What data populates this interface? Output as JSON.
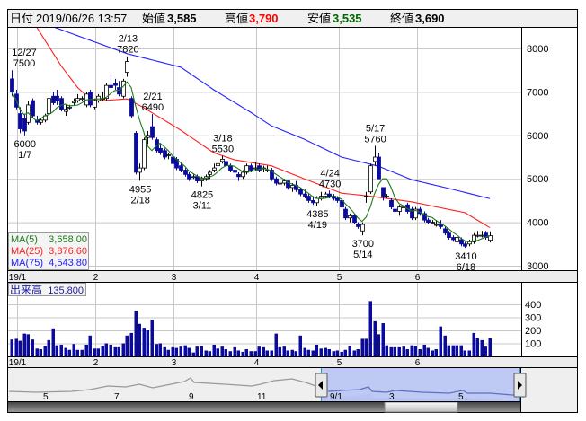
{
  "header": {
    "date_label": "日付",
    "date_value": "2019/06/26 13:57",
    "open_label": "始値",
    "open_value": "3,585",
    "high_label": "高値",
    "high_value": "3,790",
    "low_label": "安値",
    "low_value": "3,535",
    "close_label": "終値",
    "close_value": "3,690"
  },
  "colors": {
    "up": "#ffffff",
    "down": "#0a0a9c",
    "ma5": "#1a7a1a",
    "ma25": "#ff2020",
    "ma75": "#2020ff",
    "high": "#ff0000",
    "low": "#006600"
  },
  "legend": [
    {
      "label": "MA(5)",
      "value": "3,658.00",
      "color": "#1a7a1a"
    },
    {
      "label": "MA(25)",
      "value": "3,876.60",
      "color": "#ff2020"
    },
    {
      "label": "MA(75)",
      "value": "4,543.80",
      "color": "#2020ff"
    }
  ],
  "volume_legend": {
    "label": "出来高",
    "value": "135.800"
  },
  "chart_data": {
    "type": "candlestick",
    "price_axis": {
      "ticks": [
        "8000",
        "7000",
        "6000",
        "5000",
        "4000",
        "3000"
      ],
      "values": [
        8000,
        7000,
        6000,
        5000,
        4000,
        3000
      ]
    },
    "volume_axis": {
      "ticks": [
        "400",
        "300",
        "200",
        "100"
      ],
      "values": [
        400,
        300,
        200,
        100
      ]
    },
    "month_ticks": [
      {
        "label": "19/1",
        "index": 2
      },
      {
        "label": "2",
        "index": 21
      },
      {
        "label": "3",
        "index": 40
      },
      {
        "label": "4",
        "index": 60
      },
      {
        "label": "5",
        "index": 80
      },
      {
        "label": "6",
        "index": 99
      }
    ],
    "ohlc": [
      [
        7300,
        7500,
        6900,
        7000
      ],
      [
        6950,
        7050,
        6600,
        6650
      ],
      [
        6500,
        6650,
        6050,
        6150
      ],
      [
        6400,
        6500,
        6000,
        6100
      ],
      [
        6300,
        6800,
        6250,
        6700
      ],
      [
        6800,
        6850,
        6400,
        6450
      ],
      [
        6350,
        6450,
        6250,
        6300
      ],
      [
        6300,
        6400,
        6250,
        6350
      ],
      [
        6350,
        6500,
        6300,
        6450
      ],
      [
        6500,
        6900,
        6450,
        6850
      ],
      [
        6900,
        7000,
        6700,
        6750
      ],
      [
        6900,
        7050,
        6700,
        6800
      ],
      [
        6850,
        6900,
        6550,
        6600
      ],
      [
        6550,
        6700,
        6450,
        6600
      ],
      [
        6650,
        6700,
        6600,
        6650
      ],
      [
        6750,
        6850,
        6700,
        6780
      ],
      [
        6800,
        6950,
        6750,
        6850
      ],
      [
        6850,
        6900,
        6800,
        6850
      ],
      [
        6700,
        7000,
        6650,
        6950
      ],
      [
        7000,
        7050,
        6650,
        6700
      ],
      [
        6650,
        6850,
        6600,
        6800
      ],
      [
        6800,
        6950,
        6750,
        6900
      ],
      [
        6850,
        7000,
        6800,
        6850
      ],
      [
        6850,
        7200,
        6800,
        7150
      ],
      [
        7150,
        7450,
        7050,
        7100
      ],
      [
        7200,
        7300,
        7050,
        7150
      ],
      [
        7100,
        7250,
        6900,
        6950
      ],
      [
        6900,
        7300,
        6850,
        7250
      ],
      [
        7450,
        7820,
        7350,
        7700
      ],
      [
        6850,
        6900,
        6400,
        6450
      ],
      [
        6050,
        6100,
        5100,
        5150
      ],
      [
        5150,
        5350,
        4955,
        5250
      ],
      [
        5250,
        5950,
        5200,
        5900
      ],
      [
        5950,
        6100,
        5800,
        6000
      ],
      [
        6200,
        6490,
        5900,
        5950
      ],
      [
        5900,
        5950,
        5600,
        5650
      ],
      [
        5700,
        5800,
        5550,
        5600
      ],
      [
        5650,
        5700,
        5450,
        5500
      ],
      [
        5550,
        5600,
        5450,
        5550
      ],
      [
        5500,
        5550,
        5300,
        5350
      ],
      [
        5450,
        5500,
        5200,
        5250
      ],
      [
        5300,
        5350,
        5150,
        5200
      ],
      [
        5200,
        5250,
        5050,
        5100
      ],
      [
        5100,
        5150,
        4950,
        5000
      ],
      [
        5050,
        5100,
        5000,
        5050
      ],
      [
        5050,
        5100,
        4900,
        4950
      ],
      [
        4950,
        5050,
        4825,
        5000
      ],
      [
        5000,
        5100,
        4950,
        5050
      ],
      [
        5100,
        5200,
        5000,
        5150
      ],
      [
        5200,
        5350,
        5150,
        5250
      ],
      [
        5300,
        5400,
        5250,
        5350
      ],
      [
        5400,
        5530,
        5350,
        5450
      ],
      [
        5400,
        5450,
        5250,
        5300
      ],
      [
        5300,
        5350,
        5150,
        5200
      ],
      [
        5200,
        5250,
        5000,
        5150
      ],
      [
        5100,
        5150,
        4950,
        5050
      ],
      [
        5050,
        5200,
        5000,
        5150
      ],
      [
        5150,
        5350,
        5100,
        5300
      ],
      [
        5300,
        5350,
        5150,
        5200
      ],
      [
        5250,
        5400,
        5200,
        5250
      ],
      [
        5300,
        5350,
        5150,
        5200
      ],
      [
        5250,
        5300,
        5150,
        5250
      ],
      [
        5200,
        5300,
        5150,
        5200
      ],
      [
        5200,
        5250,
        4950,
        5000
      ],
      [
        5000,
        5050,
        4850,
        4900
      ],
      [
        4900,
        4950,
        4850,
        4900
      ],
      [
        4900,
        5000,
        4850,
        4950
      ],
      [
        4950,
        4950,
        4750,
        4800
      ],
      [
        4800,
        4900,
        4700,
        4850
      ],
      [
        4850,
        4950,
        4700,
        4750
      ],
      [
        4750,
        4800,
        4600,
        4650
      ],
      [
        4650,
        4750,
        4550,
        4600
      ],
      [
        4600,
        4650,
        4450,
        4500
      ],
      [
        4500,
        4600,
        4400,
        4450
      ],
      [
        4450,
        4600,
        4385,
        4550
      ],
      [
        4550,
        4700,
        4500,
        4600
      ],
      [
        4600,
        4700,
        4550,
        4650
      ],
      [
        4650,
        4730,
        4550,
        4600
      ],
      [
        4600,
        4650,
        4500,
        4550
      ],
      [
        4550,
        4600,
        4450,
        4500
      ],
      [
        4500,
        4550,
        4300,
        4350
      ],
      [
        4300,
        4350,
        4050,
        4100
      ],
      [
        4100,
        4200,
        4000,
        4150
      ],
      [
        4150,
        4200,
        3950,
        4000
      ],
      [
        3950,
        4000,
        3850,
        3900
      ],
      [
        3800,
        4000,
        3700,
        3950
      ],
      [
        4600,
        4700,
        4450,
        4600
      ],
      [
        4700,
        5350,
        4650,
        5300
      ],
      [
        5400,
        5760,
        5300,
        5500
      ],
      [
        5500,
        5600,
        5000,
        5000
      ],
      [
        4800,
        4800,
        4500,
        4600
      ],
      [
        4600,
        4650,
        4550,
        4600
      ],
      [
        4500,
        4550,
        4300,
        4350
      ],
      [
        4300,
        4350,
        4200,
        4250
      ],
      [
        4250,
        4400,
        4150,
        4350
      ],
      [
        4350,
        4400,
        4300,
        4350
      ],
      [
        4400,
        4450,
        4200,
        4250
      ],
      [
        4300,
        4350,
        4050,
        4100
      ],
      [
        4100,
        4350,
        4050,
        4300
      ],
      [
        4300,
        4350,
        4150,
        4200
      ],
      [
        4200,
        4250,
        4000,
        4050
      ],
      [
        4050,
        4100,
        3950,
        4000
      ],
      [
        4000,
        4050,
        3950,
        4000
      ],
      [
        3950,
        4050,
        3900,
        3950
      ],
      [
        3950,
        4050,
        3850,
        3900
      ],
      [
        3850,
        3900,
        3700,
        3750
      ],
      [
        3750,
        3800,
        3600,
        3650
      ],
      [
        3650,
        3700,
        3550,
        3600
      ],
      [
        3550,
        3650,
        3500,
        3650
      ],
      [
        3600,
        3650,
        3450,
        3500
      ],
      [
        3500,
        3550,
        3410,
        3450
      ],
      [
        3500,
        3600,
        3450,
        3550
      ],
      [
        3550,
        3750,
        3500,
        3700
      ],
      [
        3700,
        3800,
        3650,
        3700
      ],
      [
        3700,
        3800,
        3650,
        3700
      ],
      [
        3750,
        3800,
        3600,
        3650
      ],
      [
        3585,
        3790,
        3535,
        3690
      ]
    ],
    "volume": [
      130,
      135,
      120,
      175,
      170,
      130,
      60,
      55,
      80,
      125,
      215,
      85,
      90,
      65,
      50,
      95,
      50,
      50,
      90,
      160,
      60,
      60,
      80,
      100,
      90,
      70,
      70,
      100,
      160,
      180,
      350,
      250,
      220,
      200,
      280,
      95,
      100,
      70,
      50,
      70,
      65,
      75,
      85,
      65,
      30,
      75,
      80,
      45,
      40,
      90,
      60,
      75,
      55,
      40,
      70,
      45,
      35,
      55,
      40,
      40,
      75,
      70,
      45,
      45,
      175,
      70,
      75,
      45,
      50,
      40,
      160,
      65,
      50,
      45,
      90,
      60,
      65,
      55,
      40,
      45,
      35,
      50,
      80,
      45,
      55,
      135,
      135,
      425,
      270,
      170,
      255,
      85,
      70,
      70,
      70,
      75,
      55,
      85,
      80,
      55,
      90,
      65,
      45,
      55,
      230,
      160,
      85,
      85,
      85,
      85,
      45,
      45,
      180,
      140,
      125,
      75,
      140
    ],
    "ma25_keypoints": [
      [
        0,
        9200
      ],
      [
        6,
        8500
      ],
      [
        12,
        7600
      ],
      [
        16,
        7100
      ],
      [
        19,
        6840
      ],
      [
        22,
        6800
      ],
      [
        28,
        6840
      ],
      [
        32,
        6640
      ],
      [
        41,
        6120
      ],
      [
        49,
        5600
      ],
      [
        54,
        5440
      ],
      [
        63,
        5300
      ],
      [
        71,
        5000
      ],
      [
        80,
        4670
      ],
      [
        87,
        4600
      ],
      [
        97,
        4470
      ],
      [
        110,
        4220
      ],
      [
        116,
        3877
      ]
    ],
    "ma75_keypoints": [
      [
        0,
        8950
      ],
      [
        10,
        8500
      ],
      [
        19,
        8190
      ],
      [
        28,
        7880
      ],
      [
        41,
        7570
      ],
      [
        49,
        7050
      ],
      [
        58,
        6530
      ],
      [
        63,
        6220
      ],
      [
        71,
        5910
      ],
      [
        80,
        5500
      ],
      [
        89,
        5290
      ],
      [
        97,
        4980
      ],
      [
        106,
        4780
      ],
      [
        116,
        4544
      ]
    ],
    "annotations": [
      {
        "date": "12/27",
        "price": "7500",
        "index": 0,
        "value": 7500,
        "pos": "above"
      },
      {
        "date": "2/13",
        "price": "7820",
        "index": 28,
        "value": 7820,
        "pos": "above"
      },
      {
        "date": "2/21",
        "price": "6490",
        "index": 34,
        "value": 6490,
        "pos": "above"
      },
      {
        "date": "3/18",
        "price": "5530",
        "index": 51,
        "value": 5530,
        "pos": "above"
      },
      {
        "date": "4/24",
        "price": "4730",
        "index": 77,
        "value": 4730,
        "pos": "above"
      },
      {
        "date": "5/17",
        "price": "5760",
        "index": 88,
        "value": 5760,
        "pos": "above"
      },
      {
        "date": "1/7",
        "price": "6000",
        "index": 3,
        "value": 6000,
        "pos": "below"
      },
      {
        "date": "2/18",
        "price": "4955",
        "index": 31,
        "value": 4955,
        "pos": "below"
      },
      {
        "date": "3/11",
        "price": "4825",
        "index": 46,
        "value": 4825,
        "pos": "below"
      },
      {
        "date": "4/19",
        "price": "4385",
        "index": 74,
        "value": 4385,
        "pos": "below"
      },
      {
        "date": "5/14",
        "price": "3700",
        "index": 85,
        "value": 3700,
        "pos": "below"
      },
      {
        "date": "6/18",
        "price": "3410",
        "index": 110,
        "value": 3410,
        "pos": "below"
      }
    ]
  },
  "navigator": {
    "labels_left": [
      "5",
      "7",
      "9",
      "11"
    ],
    "labels_right": [
      "9/1",
      "3",
      "5"
    ]
  }
}
